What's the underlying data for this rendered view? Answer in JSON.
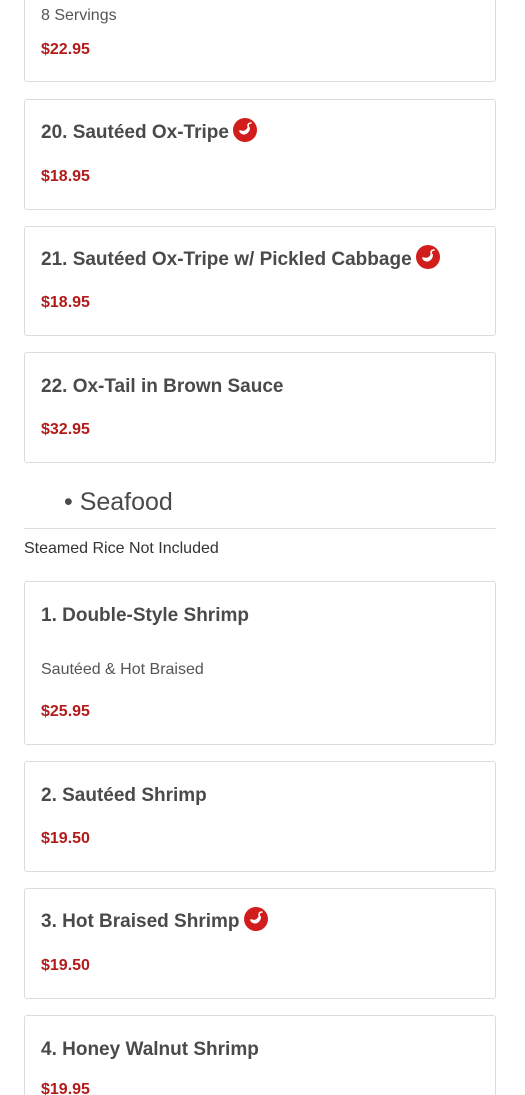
{
  "colors": {
    "price": "#b31b1b",
    "pepper": "#d21d1d",
    "border": "#dcdcdc"
  },
  "top_card": {
    "servings": "8 Servings",
    "price": "$22.95"
  },
  "items_beef": [
    {
      "name": "20. Sautéed Ox-Tripe",
      "spicy": true,
      "price": "$18.95"
    },
    {
      "name": "21. Sautéed Ox-Tripe w/ Pickled Cabbage",
      "spicy": true,
      "price": "$18.95"
    },
    {
      "name": "22. Ox-Tail in Brown Sauce",
      "spicy": false,
      "price": "$32.95"
    }
  ],
  "section": {
    "title": "• Seafood",
    "note": "Steamed Rice Not Included"
  },
  "items_seafood": [
    {
      "name": "1. Double-Style Shrimp",
      "description": "Sautéed & Hot Braised",
      "spicy": false,
      "price": "$25.95"
    },
    {
      "name": "2. Sautéed Shrimp",
      "spicy": false,
      "price": "$19.50"
    },
    {
      "name": "3. Hot Braised Shrimp",
      "spicy": true,
      "price": "$19.50"
    },
    {
      "name": "4. Honey Walnut Shrimp",
      "spicy": false,
      "price": "$19.95"
    }
  ],
  "icons": {
    "spicy": "pepper-icon"
  }
}
